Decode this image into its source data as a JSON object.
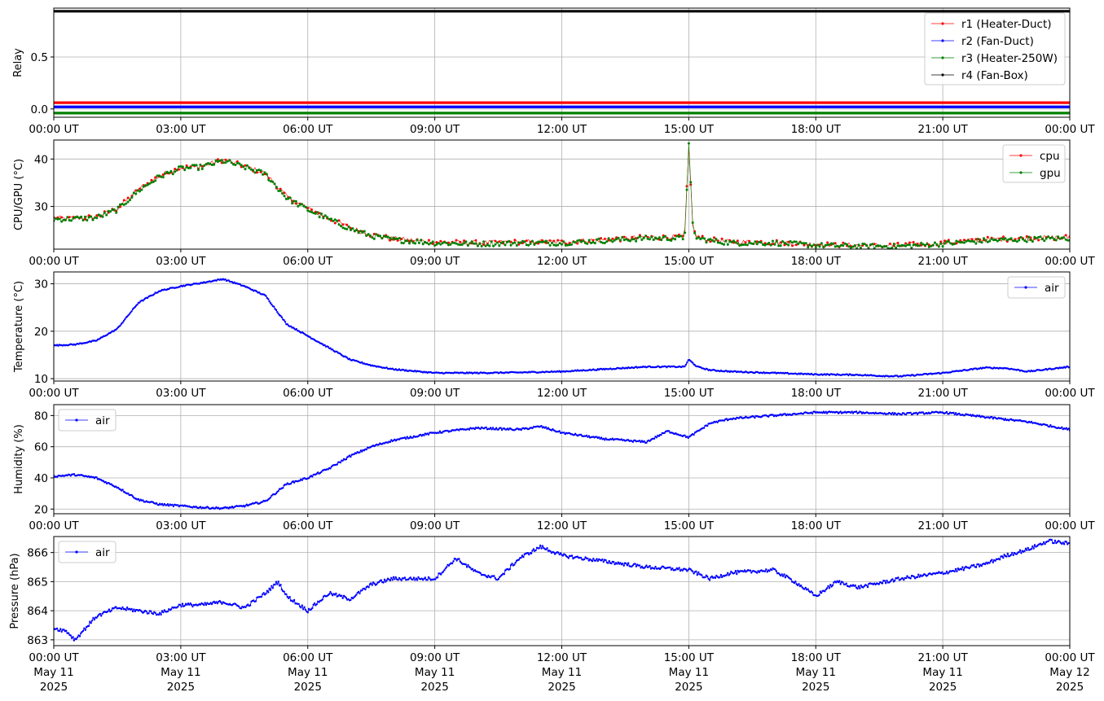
{
  "x_tick_labels": [
    "00:00 UT",
    "03:00 UT",
    "06:00 UT",
    "09:00 UT",
    "12:00 UT",
    "15:00 UT",
    "18:00 UT",
    "21:00 UT",
    "00:00 UT"
  ],
  "x_date_lines": [
    [
      "May 11",
      "2025"
    ],
    [
      "May 11",
      "2025"
    ],
    [
      "May 11",
      "2025"
    ],
    [
      "May 11",
      "2025"
    ],
    [
      "May 11",
      "2025"
    ],
    [
      "May 11",
      "2025"
    ],
    [
      "May 11",
      "2025"
    ],
    [
      "May 11",
      "2025"
    ],
    [
      "May 12",
      "2025"
    ]
  ],
  "chart_data": [
    {
      "type": "line",
      "ylabel": "Relay",
      "x_unit": "hours UT from 2025-05-11 00:00",
      "xlim": [
        0,
        24
      ],
      "ylim": [
        -0.08,
        0.97
      ],
      "yticks": [
        0.0,
        0.5
      ],
      "ytick_labels": [
        "0.0",
        "0.5"
      ],
      "grid": true,
      "legend": "top-right",
      "series": [
        {
          "name": "r1 (Heater-Duct)",
          "color": "#ff0000",
          "x": [
            0,
            24
          ],
          "y": [
            0.06,
            0.06
          ]
        },
        {
          "name": "r2 (Fan-Duct)",
          "color": "#0000ff",
          "x": [
            0,
            24
          ],
          "y": [
            0.02,
            0.02
          ]
        },
        {
          "name": "r3 (Heater-250W)",
          "color": "#008000",
          "x": [
            0,
            24
          ],
          "y": [
            -0.04,
            -0.04
          ]
        },
        {
          "name": "r4 (Fan-Box)",
          "color": "#000000",
          "x": [
            0,
            24
          ],
          "y": [
            0.94,
            0.94
          ]
        }
      ]
    },
    {
      "type": "line",
      "ylabel": "CPU/GPU (°C)",
      "xlim": [
        0,
        24
      ],
      "ylim": [
        21,
        44
      ],
      "yticks": [
        30,
        40
      ],
      "ytick_labels": [
        "30",
        "40"
      ],
      "grid": true,
      "legend": "top-right",
      "series": [
        {
          "name": "cpu",
          "color": "#ff0000",
          "x": [
            0,
            0.5,
            1,
            1.5,
            2,
            2.5,
            3,
            3.5,
            4,
            4.5,
            5,
            5.5,
            6,
            6.5,
            7,
            7.5,
            8,
            9,
            10,
            11,
            12,
            13,
            14,
            14.9,
            15.0,
            15.1,
            15.2,
            15.5,
            16,
            17,
            18,
            19,
            20,
            21,
            22,
            23,
            24
          ],
          "y": [
            27.5,
            27.5,
            27.8,
            29.5,
            33.5,
            36.5,
            38.2,
            38.5,
            39.8,
            38.5,
            37,
            32,
            29.5,
            27.5,
            25.5,
            24,
            23.2,
            22.5,
            22.3,
            22.5,
            22.5,
            23,
            23.5,
            23.5,
            42.5,
            25,
            23.5,
            23,
            22.5,
            22.5,
            22,
            21.8,
            21.8,
            22.3,
            23,
            23.3,
            23.5
          ]
        },
        {
          "name": "gpu",
          "color": "#008000",
          "x": [
            0,
            0.5,
            1,
            1.5,
            2,
            2.5,
            3,
            3.5,
            4,
            4.5,
            5,
            5.5,
            6,
            6.5,
            7,
            7.5,
            8,
            9,
            10,
            11,
            12,
            13,
            14,
            14.9,
            15.0,
            15.1,
            15.2,
            15.5,
            16,
            17,
            18,
            19,
            20,
            21,
            22,
            23,
            24
          ],
          "y": [
            27.3,
            27.4,
            27.6,
            29.3,
            33.3,
            36.3,
            38.0,
            38.3,
            39.6,
            38.3,
            36.8,
            31.8,
            29.3,
            27.3,
            25.3,
            23.8,
            23.0,
            22.3,
            22.1,
            22.3,
            22.3,
            22.8,
            23.3,
            23.3,
            43.0,
            24.8,
            23.3,
            22.8,
            22.3,
            22.3,
            21.8,
            21.6,
            21.6,
            22.1,
            22.8,
            23.1,
            23.3
          ]
        }
      ]
    },
    {
      "type": "line",
      "ylabel": "Temperature (°C)",
      "xlim": [
        0,
        24
      ],
      "ylim": [
        9.5,
        32.5
      ],
      "yticks": [
        10,
        20,
        30
      ],
      "ytick_labels": [
        "10",
        "20",
        "30"
      ],
      "grid": true,
      "legend": "top-right",
      "series": [
        {
          "name": "air",
          "color": "#0000ff",
          "x": [
            0,
            0.5,
            1,
            1.5,
            2,
            2.5,
            3,
            3.5,
            4,
            4.5,
            5,
            5.5,
            6,
            6.5,
            7,
            7.5,
            8,
            9,
            10,
            11,
            12,
            13,
            14,
            14.9,
            15.0,
            15.2,
            15.5,
            16,
            17,
            18,
            19,
            19.5,
            20,
            21,
            22,
            22.5,
            23,
            24
          ],
          "y": [
            17,
            17.2,
            18,
            20.5,
            26,
            28.5,
            29.5,
            30.2,
            31,
            29.5,
            27.5,
            21.5,
            19,
            16.5,
            14,
            12.8,
            12,
            11.2,
            11.2,
            11.3,
            11.5,
            12,
            12.5,
            12.5,
            14,
            12.5,
            11.8,
            11.5,
            11.2,
            10.9,
            10.8,
            10.6,
            10.5,
            11.2,
            12.3,
            12.2,
            11.5,
            12.5
          ]
        }
      ]
    },
    {
      "type": "line",
      "ylabel": "Humidity (%)",
      "xlim": [
        0,
        24
      ],
      "ylim": [
        17,
        87
      ],
      "yticks": [
        20,
        40,
        60,
        80
      ],
      "ytick_labels": [
        "20",
        "40",
        "60",
        "80"
      ],
      "grid": true,
      "legend": "top-left",
      "series": [
        {
          "name": "air",
          "color": "#0000ff",
          "x": [
            0,
            0.5,
            1,
            1.5,
            2,
            2.5,
            3,
            3.5,
            4,
            4.5,
            5,
            5.5,
            6,
            6.5,
            7,
            7.5,
            8,
            9,
            10,
            11,
            11.5,
            12,
            13,
            14,
            14.5,
            15,
            15.5,
            16,
            17,
            18,
            19,
            20,
            21,
            22,
            23,
            24
          ],
          "y": [
            41,
            42,
            40,
            34,
            26,
            23,
            22,
            21,
            20.5,
            22,
            25,
            36,
            40,
            46,
            54,
            60,
            64,
            69,
            72,
            71,
            73,
            69,
            65,
            63,
            70,
            66,
            75,
            78,
            80,
            82,
            82,
            81,
            82,
            79,
            76,
            71
          ]
        }
      ]
    },
    {
      "type": "line",
      "ylabel": "Pressure (hPa)",
      "xlim": [
        0,
        24
      ],
      "ylim": [
        862.8,
        866.55
      ],
      "yticks": [
        863,
        864,
        865,
        866
      ],
      "ytick_labels": [
        "863",
        "864",
        "865",
        "866"
      ],
      "grid": true,
      "legend": "top-left",
      "series": [
        {
          "name": "air",
          "color": "#0000ff",
          "x": [
            0,
            0.3,
            0.5,
            1,
            1.5,
            2,
            2.5,
            3,
            3.5,
            4,
            4.5,
            5,
            5.3,
            5.5,
            6,
            6.5,
            7,
            7.5,
            8,
            9,
            9.5,
            10,
            10.5,
            11,
            11.5,
            12,
            13,
            14,
            15,
            15.5,
            16,
            17,
            17.5,
            18,
            18.5,
            19,
            20,
            21,
            22,
            22.5,
            23,
            23.5,
            24
          ],
          "y": [
            863.4,
            863.3,
            863,
            863.8,
            864.1,
            864,
            863.9,
            864.2,
            864.2,
            864.3,
            864.1,
            864.6,
            865,
            864.5,
            864,
            864.6,
            864.4,
            864.9,
            865.1,
            865.1,
            865.8,
            865.3,
            865.1,
            865.8,
            866.2,
            865.9,
            865.7,
            865.5,
            865.4,
            865.1,
            865.3,
            865.4,
            865,
            864.5,
            865,
            864.8,
            865.1,
            865.3,
            865.6,
            865.9,
            866.1,
            866.4,
            866.3
          ]
        }
      ]
    }
  ]
}
